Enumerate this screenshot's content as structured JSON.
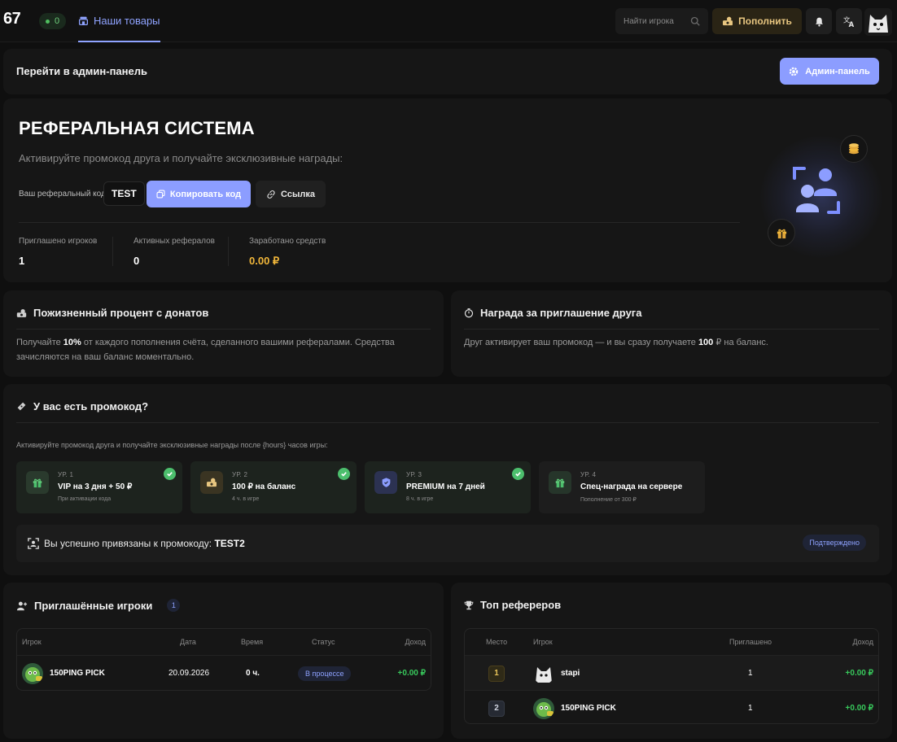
{
  "header": {
    "logo": "67",
    "online_count": "0",
    "nav_tab": "Наши товары",
    "search_placeholder": "Найти игрока",
    "topup_label": "Пополнить"
  },
  "admin": {
    "title": "Перейти в админ-панель",
    "button": "Админ-панель"
  },
  "referral": {
    "title": "РЕФЕРАЛЬНАЯ СИСТЕМА",
    "subtitle": "Активируйте промокод друга и получайте эксклюзивные награды:",
    "code_label": "Ваш реферальный код:",
    "code": "TEST",
    "copy_button": "Копировать код",
    "link_button": "Ссылка",
    "stats": [
      {
        "label": "Приглашено игроков",
        "value": "1"
      },
      {
        "label": "Активных рефералов",
        "value": "0"
      },
      {
        "label": "Заработано средств",
        "value": "0.00 ₽"
      }
    ]
  },
  "lifetime": {
    "title": "Пожизненный процент с донатов",
    "text_before": "Получайте ",
    "highlight": "10%",
    "text_after": " от каждого пополнения счёта, сделанного вашими рефералами. Средства зачисляются на ваш баланс моментально."
  },
  "invite_reward": {
    "title": "Награда за приглашение друга",
    "text_before": "Друг активирует ваш промокод — и вы сразу получаете ",
    "highlight": "100",
    "text_after": " ₽ на баланс."
  },
  "promo": {
    "title": "У вас есть промокод?",
    "subtitle": "Активируйте промокод друга и получайте эксклюзивные награды после {hours} часов игры:",
    "levels": [
      {
        "level": "УР. 1",
        "name": "VIP на 3 дня + 50 ₽",
        "desc": "При активации кода",
        "done": true,
        "icon": "gift-icon"
      },
      {
        "level": "УР. 2",
        "name": "100 ₽ на баланс",
        "desc": "4 ч. в игре",
        "done": true,
        "icon": "money-icon"
      },
      {
        "level": "УР. 3",
        "name": "PREMIUM на 7 дней",
        "desc": "8 ч. в игре",
        "done": true,
        "icon": "shield-icon"
      },
      {
        "level": "УР. 4",
        "name": "Спец-награда на сервере",
        "desc": "Пополнение от 300 ₽",
        "done": false,
        "icon": "gift-icon"
      }
    ],
    "bound_text": "Вы успешно привязаны к промокоду: ",
    "bound_code": "TEST2",
    "bound_status": "Подтверждено"
  },
  "invited": {
    "title": "Приглашённые игроки",
    "count": "1",
    "columns": [
      "Игрок",
      "Дата",
      "Время",
      "Статус",
      "Доход"
    ],
    "rows": [
      {
        "player": "150PING PICK",
        "date": "20.09.2026",
        "time": "0 ч.",
        "status": "В процессе",
        "income": "+0.00 ₽"
      }
    ]
  },
  "top": {
    "title": "Топ рефереров",
    "columns": [
      "Место",
      "Игрок",
      "Приглашено",
      "Доход"
    ],
    "rows": [
      {
        "place": "1",
        "player": "stapi",
        "invited": "1",
        "income": "+0.00 ₽"
      },
      {
        "place": "2",
        "player": "150PING PICK",
        "invited": "1",
        "income": "+0.00 ₽"
      }
    ]
  },
  "colors": {
    "accent": "#8c9dff",
    "gold": "#f0b63a",
    "success": "#38c95c"
  }
}
